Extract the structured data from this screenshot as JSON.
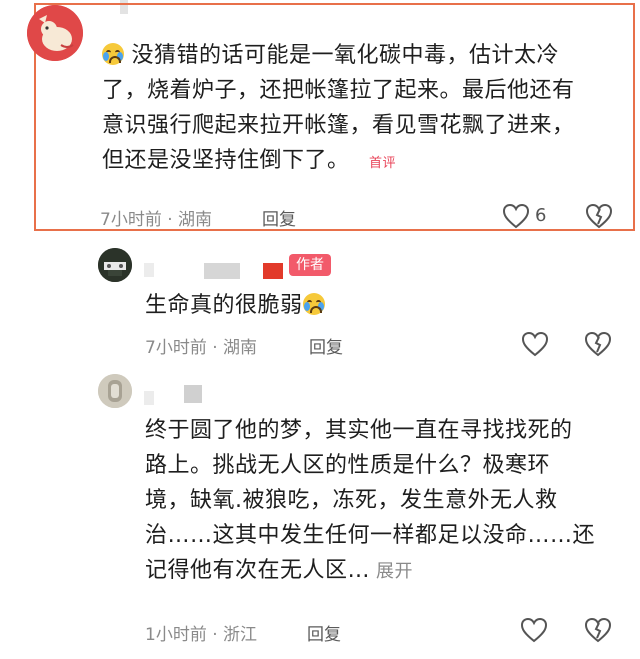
{
  "comments": [
    {
      "text_emoji": "crying-face",
      "text": "没猜错的话可能是一氧化碳中毒，估计太冷了，烧着炉子，还把帐篷拉了起来。最后他还有意识强行爬起来拉开帐篷，看见雪花飘了进来，但还是没坚持住倒下了。",
      "lines": [
        "没猜错的话可能是一氧化碳中毒，估计太冷",
        "了，烧着炉子，还把帐篷拉了起来。最后他还有",
        "意识强行爬起来拉开帐篷，看见雪花飘了进来，",
        "但还是没坚持住倒下了。"
      ],
      "badge": "首评",
      "meta": "7小时前 · 湖南",
      "reply_label": "回复",
      "like_count": "6"
    },
    {
      "author_tag": "作者",
      "text": "生命真的很脆弱",
      "text_emoji": "crying-face",
      "meta": "7小时前 · 湖南",
      "reply_label": "回复"
    },
    {
      "lines": [
        "终于圆了他的梦，其实他一直在寻找找死的",
        "路上。挑战无人区的性质是什么？极寒环",
        "境，缺氧.被狼吃，冻死，发生意外无人救",
        "治……这其中发生任何一样都足以没命……还",
        "记得他有次在无人区…"
      ],
      "expand_label": "展开",
      "meta": "1小时前 · 浙江",
      "reply_label": "回复"
    }
  ],
  "colors": {
    "highlight_border": "#e8704a",
    "author_tag_bg": "#f25a6a",
    "first_badge": "#e8455a"
  }
}
